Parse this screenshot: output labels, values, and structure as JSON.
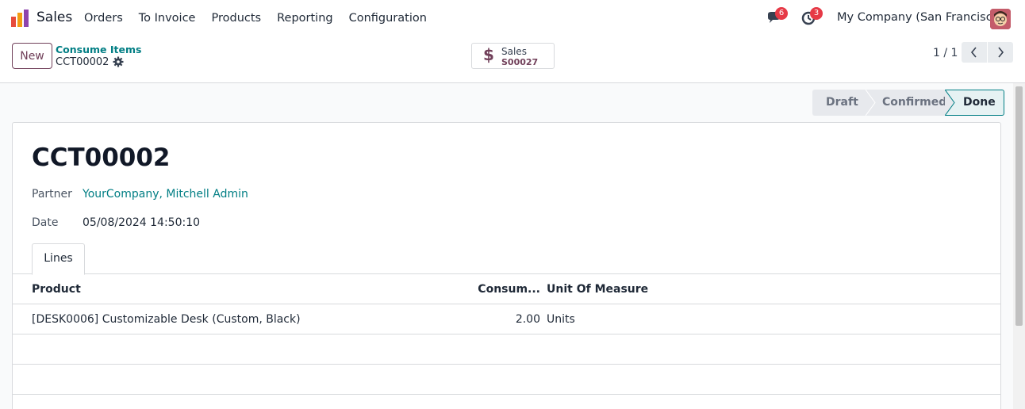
{
  "navbar": {
    "app_name": "Sales",
    "menu": [
      "Orders",
      "To Invoice",
      "Products",
      "Reporting",
      "Configuration"
    ],
    "messages_count": "6",
    "activities_count": "3",
    "company": "My Company (San Francisco)"
  },
  "control": {
    "new_label": "New",
    "breadcrumb": "Consume Items",
    "record": "CCT00002",
    "smart_button": {
      "label": "Sales",
      "value": "S00027",
      "icon": "$"
    },
    "pager": "1 / 1"
  },
  "status": {
    "stages": [
      "Draft",
      "Confirmed",
      "Done"
    ],
    "current": "Done"
  },
  "form": {
    "title": "CCT00002",
    "partner_label": "Partner",
    "partner_value": "YourCompany, Mitchell Admin",
    "date_label": "Date",
    "date_value": "05/08/2024 14:50:10",
    "tab": "Lines",
    "columns": {
      "product": "Product",
      "qty": "Consum...",
      "uom": "Unit Of Measure"
    },
    "rows": [
      {
        "product": "[DESK0006] Customizable Desk (Custom, Black)",
        "qty": "2.00",
        "uom": "Units"
      }
    ]
  },
  "colors": {
    "brand": "#71405a",
    "link": "#017e84",
    "badge": "#e63946"
  }
}
